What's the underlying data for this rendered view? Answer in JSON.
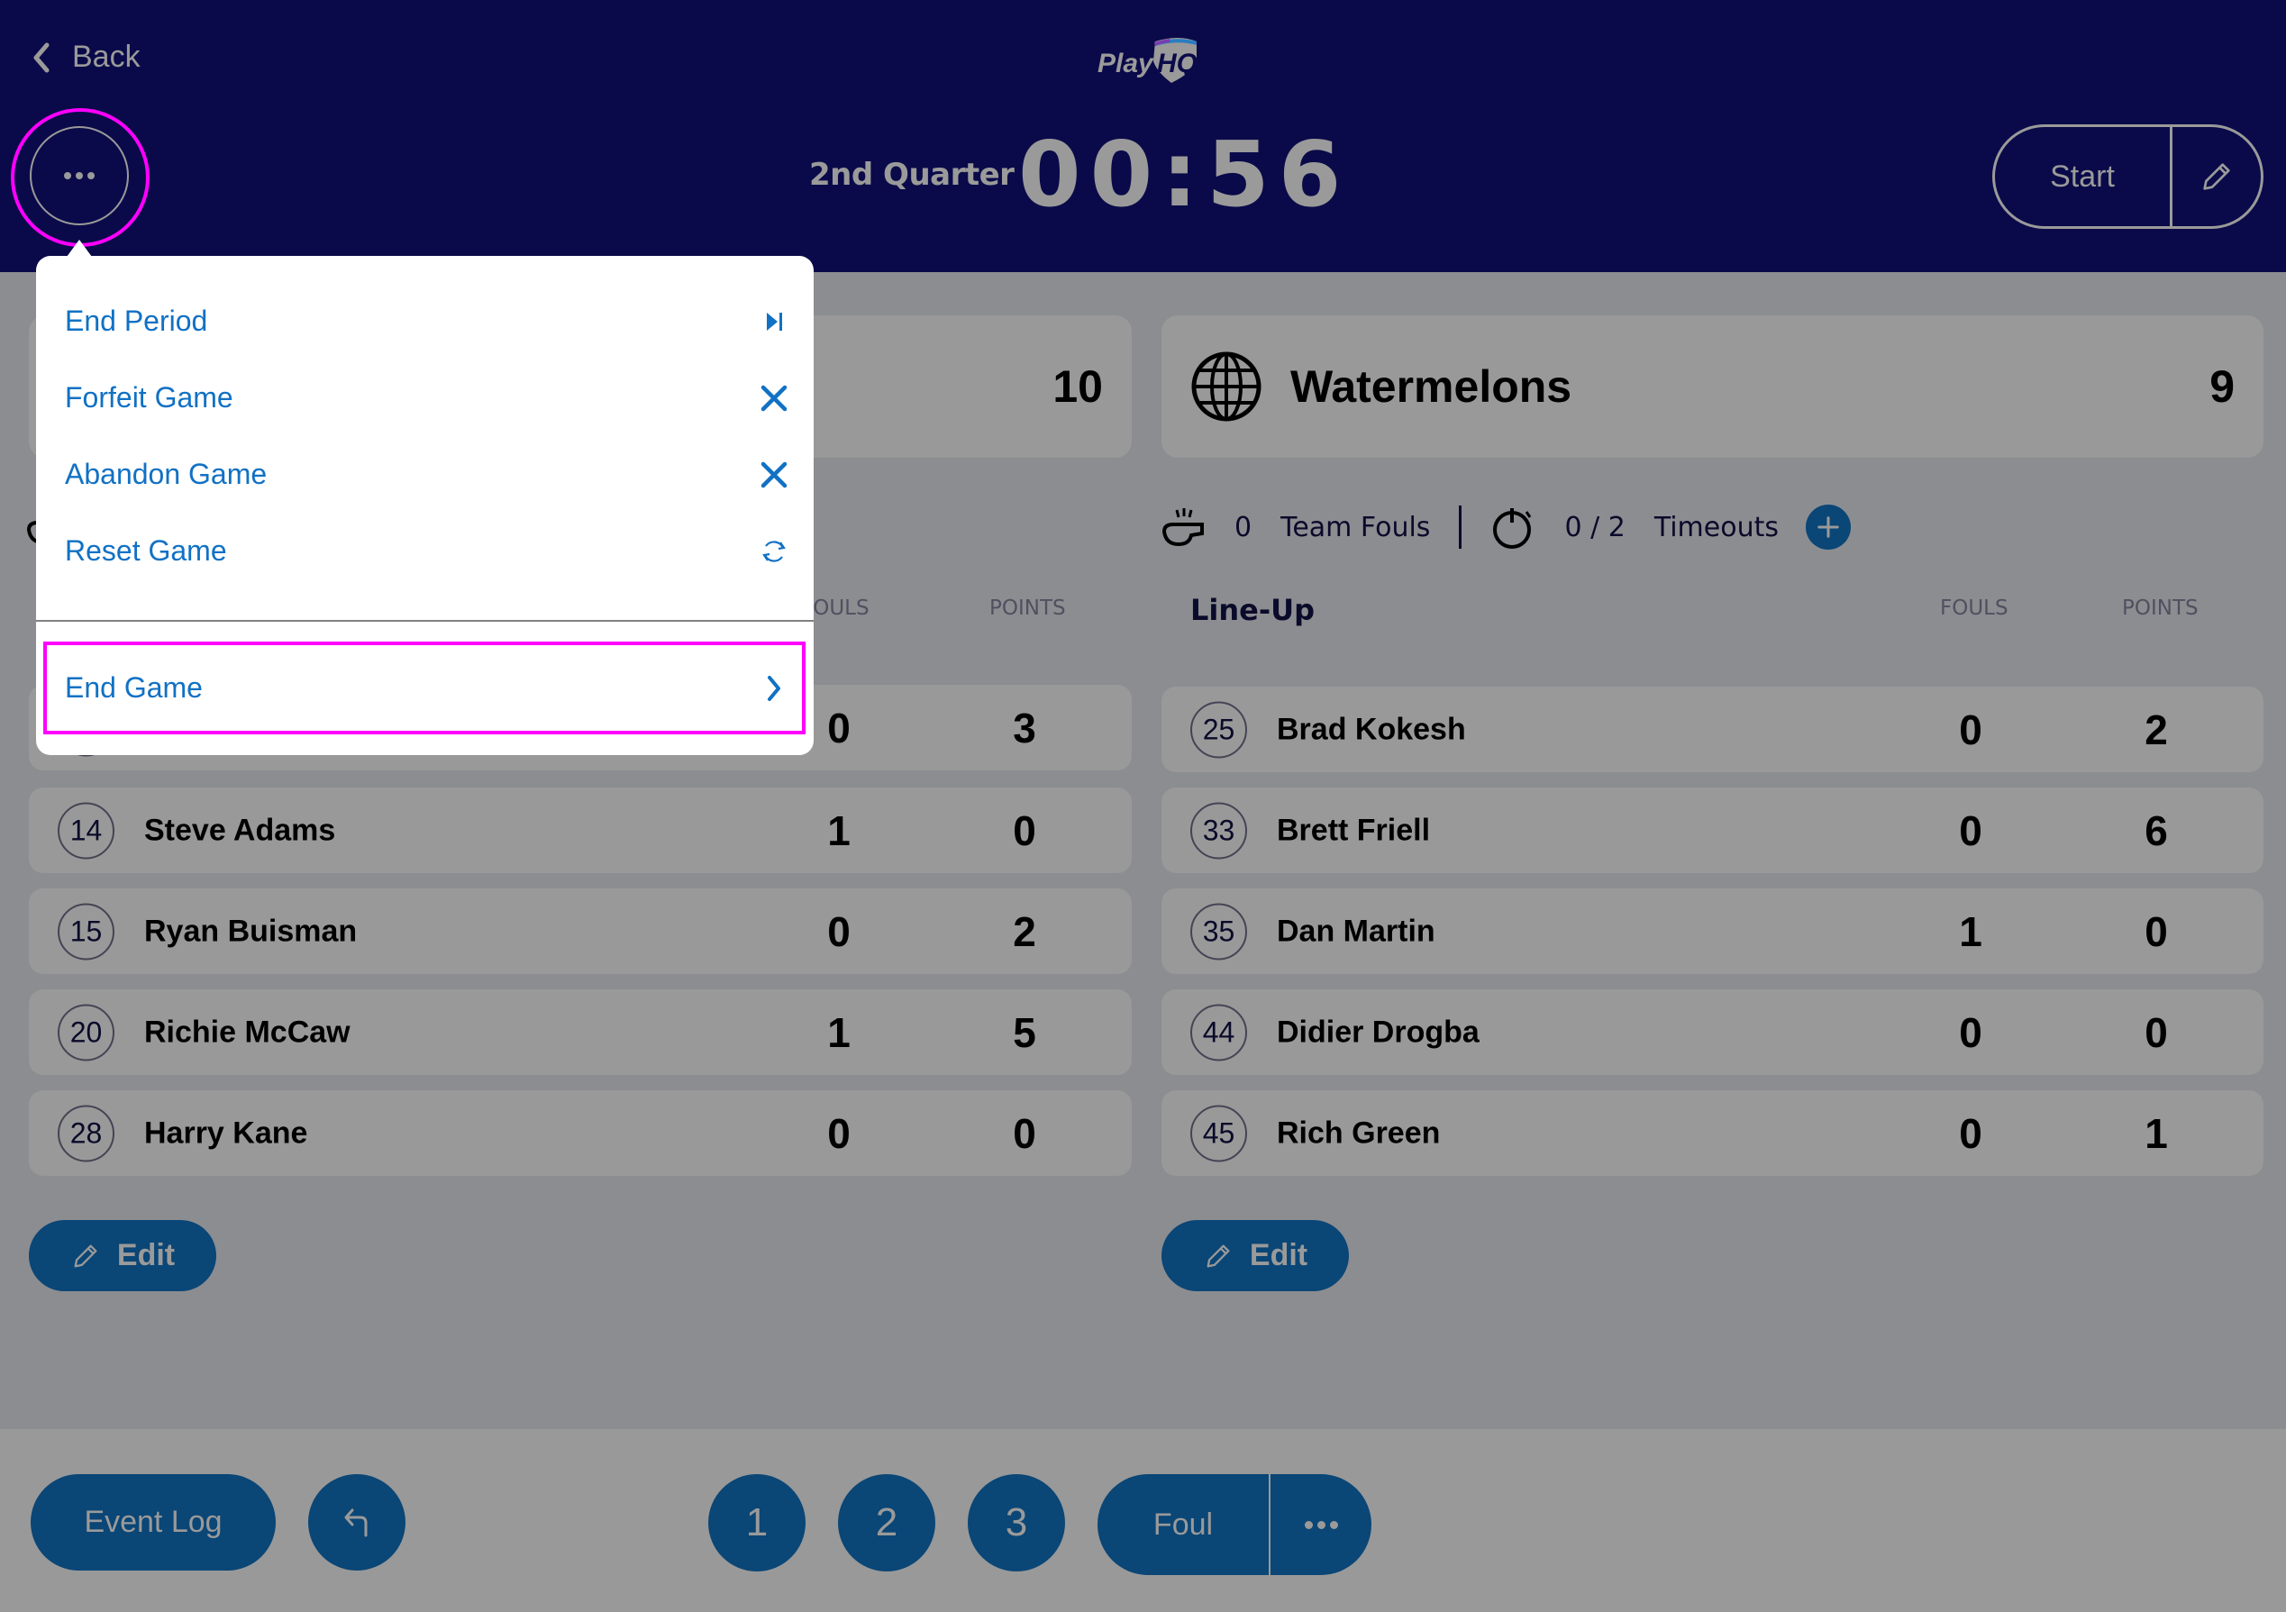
{
  "header": {
    "back_label": "Back",
    "logo_text": "PlayHQ",
    "period": "2nd Quarter",
    "clock": "00:56",
    "start_label": "Start"
  },
  "home_team": {
    "score": "10",
    "column_fouls": "FOULS",
    "column_points": "POINTS",
    "players": [
      {
        "number": "",
        "name": "",
        "fouls": "0",
        "points": "3"
      },
      {
        "number": "14",
        "name": "Steve Adams",
        "fouls": "1",
        "points": "0"
      },
      {
        "number": "15",
        "name": "Ryan Buisman",
        "fouls": "0",
        "points": "2"
      },
      {
        "number": "20",
        "name": "Richie McCaw",
        "fouls": "1",
        "points": "5"
      },
      {
        "number": "28",
        "name": "Harry Kane",
        "fouls": "0",
        "points": "0"
      }
    ],
    "edit_label": "Edit"
  },
  "away_team": {
    "name": "Watermelons",
    "score": "9",
    "team_fouls_count": "0",
    "team_fouls_label": "Team Fouls",
    "timeouts_count": "0 / 2",
    "timeouts_label": "Timeouts",
    "lineup_title": "Line-Up",
    "column_fouls": "FOULS",
    "column_points": "POINTS",
    "players": [
      {
        "number": "25",
        "name": "Brad Kokesh",
        "fouls": "0",
        "points": "2"
      },
      {
        "number": "33",
        "name": "Brett Friell",
        "fouls": "0",
        "points": "6"
      },
      {
        "number": "35",
        "name": "Dan Martin",
        "fouls": "1",
        "points": "0"
      },
      {
        "number": "44",
        "name": "Didier Drogba",
        "fouls": "0",
        "points": "0"
      },
      {
        "number": "45",
        "name": "Rich Green",
        "fouls": "0",
        "points": "1"
      }
    ],
    "edit_label": "Edit"
  },
  "bottom_bar": {
    "event_log_label": "Event Log",
    "score_buttons": [
      "1",
      "2",
      "3"
    ],
    "foul_label": "Foul"
  },
  "menu": {
    "items": [
      {
        "label": "End Period",
        "icon": "skip-forward-icon"
      },
      {
        "label": "Forfeit Game",
        "icon": "close-icon"
      },
      {
        "label": "Abandon Game",
        "icon": "close-icon"
      },
      {
        "label": "Reset Game",
        "icon": "refresh-icon"
      }
    ],
    "end_game": {
      "label": "End Game",
      "icon": "chevron-right-icon"
    }
  },
  "colors": {
    "header_bg": "#0a0a4a",
    "button_blue": "#0a4676",
    "menu_text": "#1171c4",
    "highlight": "#ff00ff",
    "overlay_bg": "#8c8d91",
    "card_bg": "#999999"
  }
}
